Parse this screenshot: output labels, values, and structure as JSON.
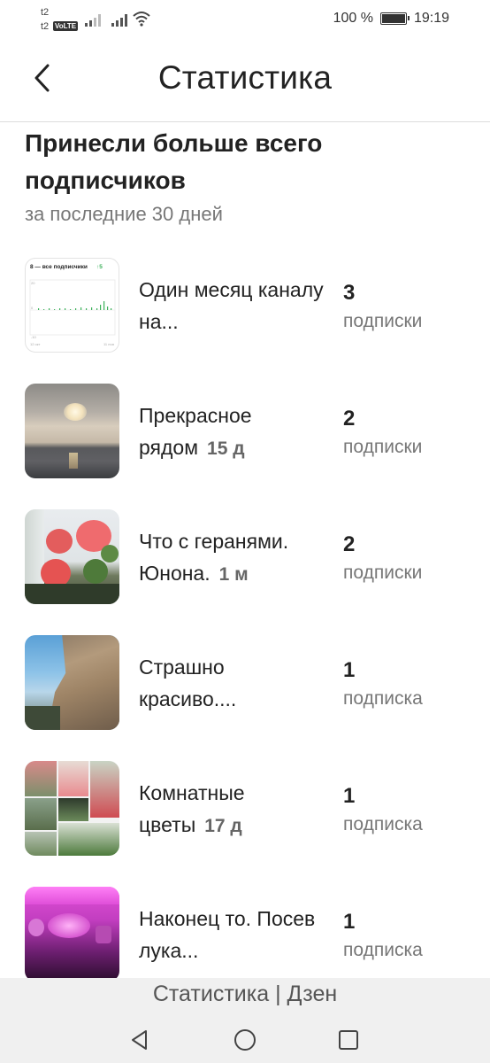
{
  "status_bar": {
    "carrier1": "t2",
    "carrier2": "t2",
    "volte": "VoLTE",
    "battery_text": "100 %",
    "time": "19:19"
  },
  "header": {
    "title": "Статистика",
    "back_icon": "back-arrow-icon"
  },
  "section": {
    "heading": "Принесли больше всего подписчиков",
    "subheading": "за последние 30 дней"
  },
  "chart_thumb": {
    "label": "8 — все подписчики",
    "badge": "↑5",
    "tick_top": "20",
    "tick_mid": "0",
    "tick_bottom": "-10",
    "date_start": "12 окт",
    "date_end": "11 ноя"
  },
  "items": [
    {
      "title": "Один месяц каналу на...",
      "age": "",
      "count": "3",
      "unit": "подписки",
      "thumb": "chart"
    },
    {
      "title": "Прекрасное рядом",
      "age": "15 д",
      "count": "2",
      "unit": "подписки",
      "thumb": "sunset"
    },
    {
      "title": "Что с геранями. Юнона.",
      "age": "1 м",
      "count": "2",
      "unit": "подписки",
      "thumb": "geranium"
    },
    {
      "title": "Страшно красиво....",
      "age": "",
      "count": "1",
      "unit": "подписка",
      "thumb": "rocks"
    },
    {
      "title": "Комнатные цветы",
      "age": "17 д",
      "count": "1",
      "unit": "подписка",
      "thumb": "collage"
    },
    {
      "title": "Наконец то. Посев лука...",
      "age": "",
      "count": "1",
      "unit": "подписка",
      "thumb": "pink-light"
    }
  ],
  "footer": {
    "title": "Статистика | Дзен"
  },
  "colors": {
    "accent_green": "#3cb15a",
    "divider": "#dcdcdc",
    "footer_bg": "#f0f0f0"
  }
}
